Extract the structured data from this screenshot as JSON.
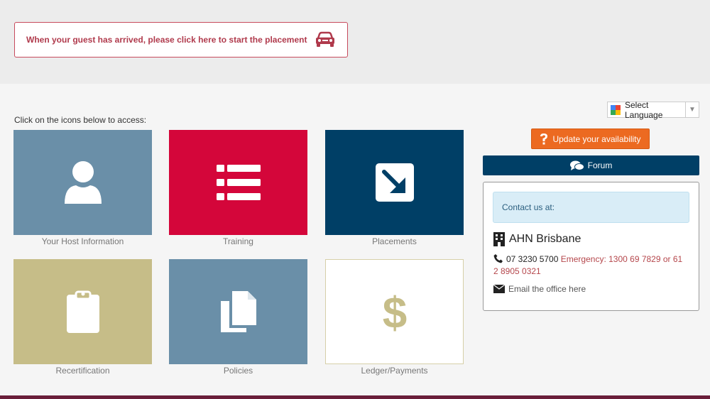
{
  "banner": {
    "text": "When your guest has arrived, please click here to start the placement",
    "icon": "car-icon",
    "color": "#b03a4c"
  },
  "instructions": "Click on the icons below to access:",
  "tiles": [
    {
      "label": "Your Host Information",
      "icon": "user-icon",
      "color": "#6a8fa8"
    },
    {
      "label": "Training",
      "icon": "list-icon",
      "color": "#d4063a"
    },
    {
      "label": "Placements",
      "icon": "arrow-down-right-icon",
      "color": "#003f66"
    },
    {
      "label": "Recertification",
      "icon": "clipboard-icon",
      "color": "#c6bd88"
    },
    {
      "label": "Policies",
      "icon": "copy-documents-icon",
      "color": "#6a8fa8"
    },
    {
      "label": "Ledger/Payments",
      "icon": "dollar-icon",
      "color": "#ffffff"
    }
  ],
  "language_selector": {
    "label": "Select Language",
    "icon": "google-translate-icon"
  },
  "availability_button": {
    "label": "Update your availability",
    "icon": "question-icon",
    "color": "#ec6a21"
  },
  "forum_button": {
    "label": "Forum",
    "icon": "comments-icon",
    "color": "#003f66"
  },
  "contact": {
    "header": "Contact us at:",
    "office_name": "AHN Brisbane",
    "phone": "07 3230 5700",
    "emergency": "Emergency: 1300 69 7829 or 61 2 8905 0321",
    "email_link": "Email the office here"
  }
}
